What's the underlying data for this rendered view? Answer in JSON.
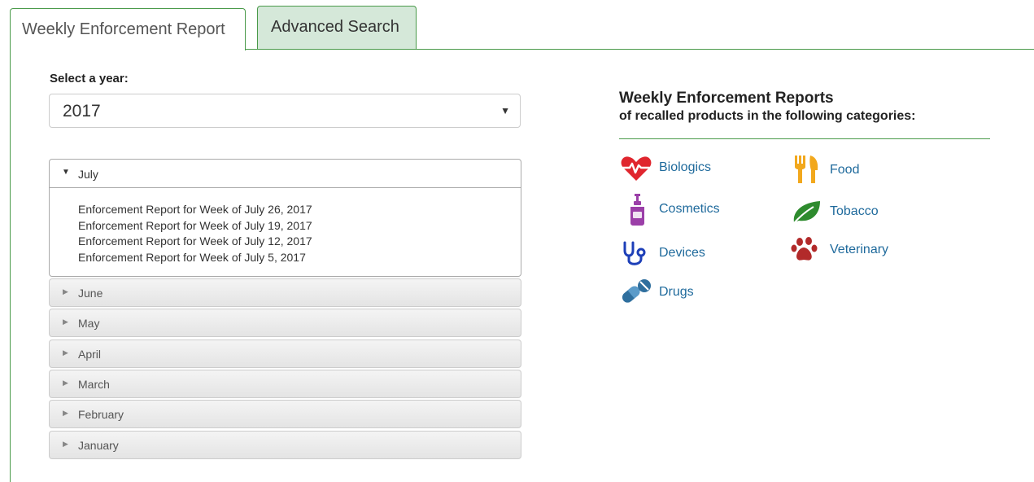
{
  "tabs": [
    {
      "label": "Weekly Enforcement Report",
      "active": true
    },
    {
      "label": "Advanced Search",
      "active": false
    }
  ],
  "year_select": {
    "label": "Select a year:",
    "value": "2017"
  },
  "accordion": {
    "open_month": "July",
    "links": [
      "Enforcement Report for Week of July 26, 2017",
      "Enforcement Report for Week of July 19, 2017",
      "Enforcement Report for Week of July 12, 2017",
      "Enforcement Report for Week of July 5, 2017"
    ],
    "closed_months": [
      "June",
      "May",
      "April",
      "March",
      "February",
      "January"
    ]
  },
  "categories_panel": {
    "title": "Weekly Enforcement Reports",
    "subtitle": "of recalled products in the following categories:",
    "items": [
      {
        "name": "Biologics",
        "icon": "heart-pulse-icon",
        "color": "#e0262e"
      },
      {
        "name": "Cosmetics",
        "icon": "lotion-bottle-icon",
        "color": "#9b3fa8"
      },
      {
        "name": "Devices",
        "icon": "stethoscope-icon",
        "color": "#1d3fb8"
      },
      {
        "name": "Drugs",
        "icon": "pills-icon",
        "color": "#2f6f9e"
      },
      {
        "name": "Food",
        "icon": "fork-knife-icon",
        "color": "#f2a81d"
      },
      {
        "name": "Tobacco",
        "icon": "leaf-icon",
        "color": "#2e8b2e"
      },
      {
        "name": "Veterinary",
        "icon": "paw-icon",
        "color": "#b22a2a"
      }
    ]
  },
  "colors": {
    "tab_border": "#4a9a4a",
    "advanced_tab_bg": "#d5e8d9",
    "link": "#1f6a9c"
  }
}
